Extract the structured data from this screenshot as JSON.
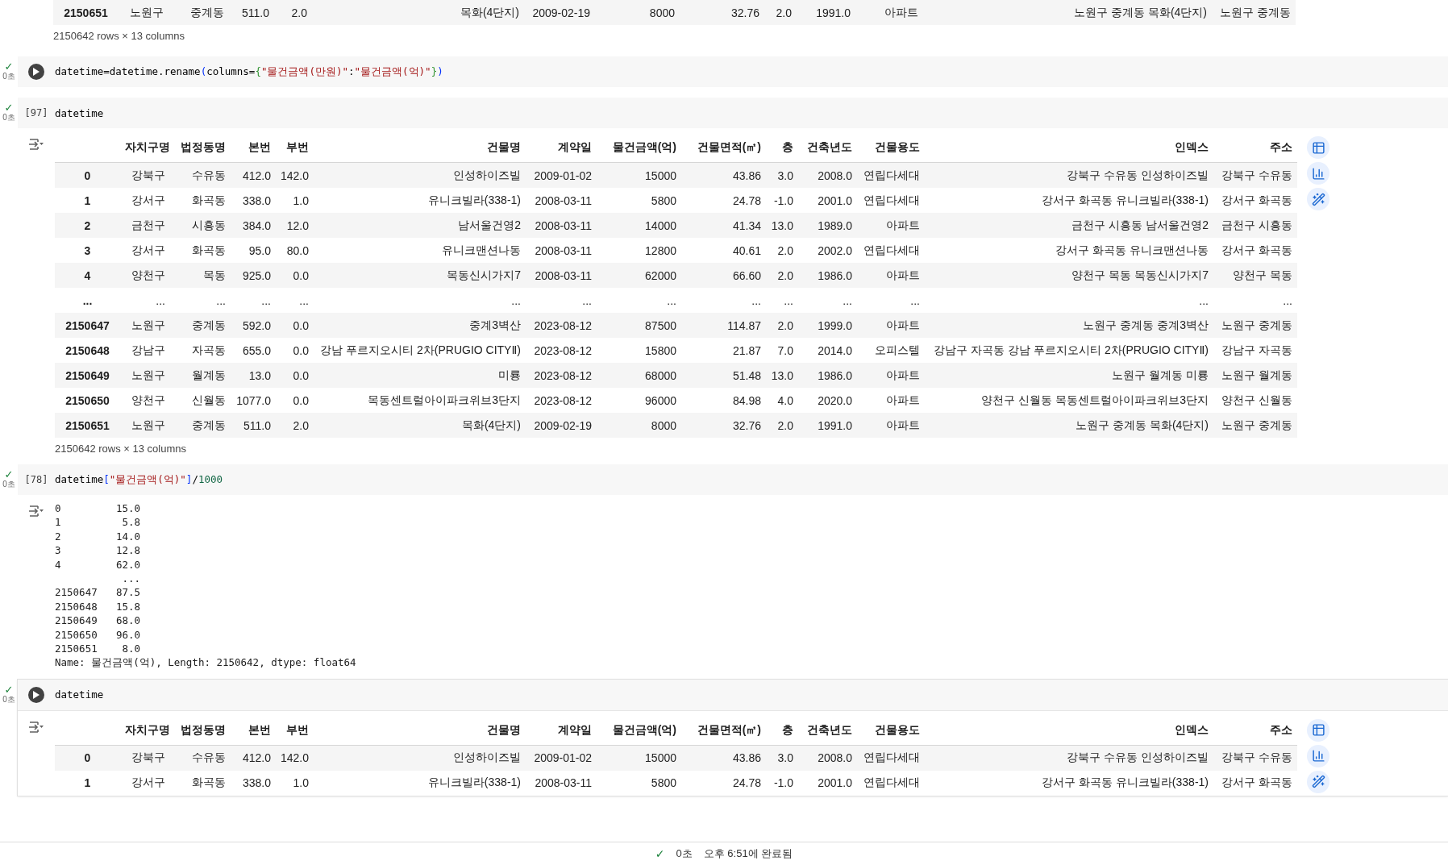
{
  "fragment": {
    "rows": [
      {
        "index": "2150651",
        "cells": [
          "노원구",
          "중계동",
          "511.0",
          "2.0",
          "목화(4단지)",
          "2009-02-19",
          "8000",
          "32.76",
          "2.0",
          "1991.0",
          "아파트",
          "노원구 중계동 목화(4단지)",
          "노원구 중계동"
        ]
      }
    ],
    "summary": "2150642 rows × 13 columns"
  },
  "cells": [
    {
      "status": "✓",
      "duration": "0초",
      "exec": {
        "kind": "run"
      },
      "focused": false,
      "code": [
        {
          "kind": "plain",
          "text": "datetime=datetime.rename"
        },
        {
          "kind": "bracket1",
          "text": "("
        },
        {
          "kind": "plain",
          "text": "columns="
        },
        {
          "kind": "bracket2",
          "text": "{"
        },
        {
          "kind": "string",
          "text": "\"물건금액(만원)\""
        },
        {
          "kind": "plain",
          "text": ":"
        },
        {
          "kind": "string",
          "text": "\"물건금액(억)\""
        },
        {
          "kind": "bracket2",
          "text": "}"
        },
        {
          "kind": "bracket1",
          "text": ")"
        }
      ]
    },
    {
      "status": "✓",
      "duration": "0초",
      "exec": {
        "kind": "count",
        "label": "[97]"
      },
      "focused": false,
      "code": [
        {
          "kind": "plain",
          "text": "datetime"
        }
      ],
      "output": {
        "kind": "table",
        "columns": [
          "자치구명",
          "법정동명",
          "본번",
          "부번",
          "건물명",
          "계약일",
          "물건금액(억)",
          "건물면적(㎡)",
          "층",
          "건축년도",
          "건물용도",
          "인덱스",
          "주소"
        ],
        "rows": [
          {
            "index": "0",
            "cells": [
              "강북구",
              "수유동",
              "412.0",
              "142.0",
              "인성하이즈빌",
              "2009-01-02",
              "15000",
              "43.86",
              "3.0",
              "2008.0",
              "연립다세대",
              "강북구 수유동 인성하이즈빌",
              "강북구 수유동"
            ]
          },
          {
            "index": "1",
            "cells": [
              "강서구",
              "화곡동",
              "338.0",
              "1.0",
              "유니크빌라(338-1)",
              "2008-03-11",
              "5800",
              "24.78",
              "-1.0",
              "2001.0",
              "연립다세대",
              "강서구 화곡동 유니크빌라(338-1)",
              "강서구 화곡동"
            ]
          },
          {
            "index": "2",
            "cells": [
              "금천구",
              "시흥동",
              "384.0",
              "12.0",
              "남서울건영2",
              "2008-03-11",
              "14000",
              "41.34",
              "13.0",
              "1989.0",
              "아파트",
              "금천구 시흥동 남서울건영2",
              "금천구 시흥동"
            ]
          },
          {
            "index": "3",
            "cells": [
              "강서구",
              "화곡동",
              "95.0",
              "80.0",
              "유니크맨션나동",
              "2008-03-11",
              "12800",
              "40.61",
              "2.0",
              "2002.0",
              "연립다세대",
              "강서구 화곡동 유니크맨션나동",
              "강서구 화곡동"
            ]
          },
          {
            "index": "4",
            "cells": [
              "양천구",
              "목동",
              "925.0",
              "0.0",
              "목동신시가지7",
              "2008-03-11",
              "62000",
              "66.60",
              "2.0",
              "1986.0",
              "아파트",
              "양천구 목동 목동신시가지7",
              "양천구 목동"
            ]
          },
          {
            "index": "...",
            "cells": [
              "...",
              "...",
              "...",
              "...",
              "...",
              "...",
              "...",
              "...",
              "...",
              "...",
              "...",
              "...",
              "..."
            ]
          },
          {
            "index": "2150647",
            "cells": [
              "노원구",
              "중계동",
              "592.0",
              "0.0",
              "중계3벽산",
              "2023-08-12",
              "87500",
              "114.87",
              "2.0",
              "1999.0",
              "아파트",
              "노원구 중계동 중계3벽산",
              "노원구 중계동"
            ]
          },
          {
            "index": "2150648",
            "cells": [
              "강남구",
              "자곡동",
              "655.0",
              "0.0",
              "강남 푸르지오시티 2차(PRUGIO CITYⅡ)",
              "2023-08-12",
              "15800",
              "21.87",
              "7.0",
              "2014.0",
              "오피스텔",
              "강남구 자곡동 강남 푸르지오시티 2차(PRUGIO CITYⅡ)",
              "강남구 자곡동"
            ]
          },
          {
            "index": "2150649",
            "cells": [
              "노원구",
              "월계동",
              "13.0",
              "0.0",
              "미룡",
              "2023-08-12",
              "68000",
              "51.48",
              "13.0",
              "1986.0",
              "아파트",
              "노원구 월계동 미룡",
              "노원구 월계동"
            ]
          },
          {
            "index": "2150650",
            "cells": [
              "양천구",
              "신월동",
              "1077.0",
              "0.0",
              "목동센트럴아이파크위브3단지",
              "2023-08-12",
              "96000",
              "84.98",
              "4.0",
              "2020.0",
              "아파트",
              "양천구 신월동 목동센트럴아이파크위브3단지",
              "양천구 신월동"
            ]
          },
          {
            "index": "2150651",
            "cells": [
              "노원구",
              "중계동",
              "511.0",
              "2.0",
              "목화(4단지)",
              "2009-02-19",
              "8000",
              "32.76",
              "2.0",
              "1991.0",
              "아파트",
              "노원구 중계동 목화(4단지)",
              "노원구 중계동"
            ]
          }
        ],
        "summary": "2150642 rows × 13 columns"
      }
    },
    {
      "status": "✓",
      "duration": "0초",
      "exec": {
        "kind": "count",
        "label": "[78]"
      },
      "focused": false,
      "code": [
        {
          "kind": "plain",
          "text": "datetime"
        },
        {
          "kind": "bracket1",
          "text": "["
        },
        {
          "kind": "string",
          "text": "\"물건금액(억)\""
        },
        {
          "kind": "bracket1",
          "text": "]"
        },
        {
          "kind": "plain",
          "text": "/"
        },
        {
          "kind": "number",
          "text": "1000"
        }
      ],
      "output": {
        "kind": "series",
        "head": [
          {
            "index": "0",
            "value": "15.0"
          },
          {
            "index": "1",
            "value": "5.8"
          },
          {
            "index": "2",
            "value": "14.0"
          },
          {
            "index": "3",
            "value": "12.8"
          },
          {
            "index": "4",
            "value": "62.0"
          }
        ],
        "ellipsis": "...",
        "tail": [
          {
            "index": "2150647",
            "value": "87.5"
          },
          {
            "index": "2150648",
            "value": "15.8"
          },
          {
            "index": "2150649",
            "value": "68.0"
          },
          {
            "index": "2150650",
            "value": "96.0"
          },
          {
            "index": "2150651",
            "value": "8.0"
          }
        ],
        "footer": "Name: 물건금액(억), Length: 2150642, dtype: float64"
      }
    },
    {
      "status": "✓",
      "duration": "0초",
      "exec": {
        "kind": "run"
      },
      "focused": true,
      "code": [
        {
          "kind": "plain",
          "text": "datetime"
        }
      ],
      "output": {
        "kind": "table",
        "columns": [
          "자치구명",
          "법정동명",
          "본번",
          "부번",
          "건물명",
          "계약일",
          "물건금액(억)",
          "건물면적(㎡)",
          "층",
          "건축년도",
          "건물용도",
          "인덱스",
          "주소"
        ],
        "rows": [
          {
            "index": "0",
            "cells": [
              "강북구",
              "수유동",
              "412.0",
              "142.0",
              "인성하이즈빌",
              "2009-01-02",
              "15000",
              "43.86",
              "3.0",
              "2008.0",
              "연립다세대",
              "강북구 수유동 인성하이즈빌",
              "강북구 수유동"
            ]
          },
          {
            "index": "1",
            "cells": [
              "강서구",
              "화곡동",
              "338.0",
              "1.0",
              "유니크빌라(338-1)",
              "2008-03-11",
              "5800",
              "24.78",
              "-1.0",
              "2001.0",
              "연립다세대",
              "강서구 화곡동 유니크빌라(338-1)",
              "강서구 화곡동"
            ]
          }
        ]
      }
    }
  ],
  "status_bar": {
    "check": "✓",
    "duration": "0초",
    "message": "오후 6:51에 완료됨"
  }
}
